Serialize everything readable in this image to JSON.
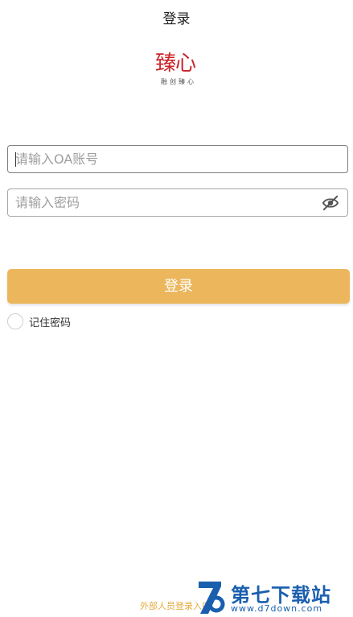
{
  "nav": {
    "title": "登录"
  },
  "logo": {
    "mark": "臻心",
    "slogan": "融创臻心"
  },
  "form": {
    "account_placeholder": "请输入OA账号",
    "password_placeholder": "请输入密码",
    "login_label": "登录",
    "remember_label": "记住密码"
  },
  "footer": {
    "external_login": "外部人员登录入口"
  },
  "watermark": {
    "title": "第七下载站",
    "url": "www.d7down.com"
  },
  "colors": {
    "accent": "#ecb75c",
    "link": "#e5a93a",
    "logo": "#c9262c",
    "watermark": "#1a5fae"
  },
  "icons": {
    "password_toggle": "eye-slash-icon",
    "watermark_logo": "d7-logo-icon"
  }
}
